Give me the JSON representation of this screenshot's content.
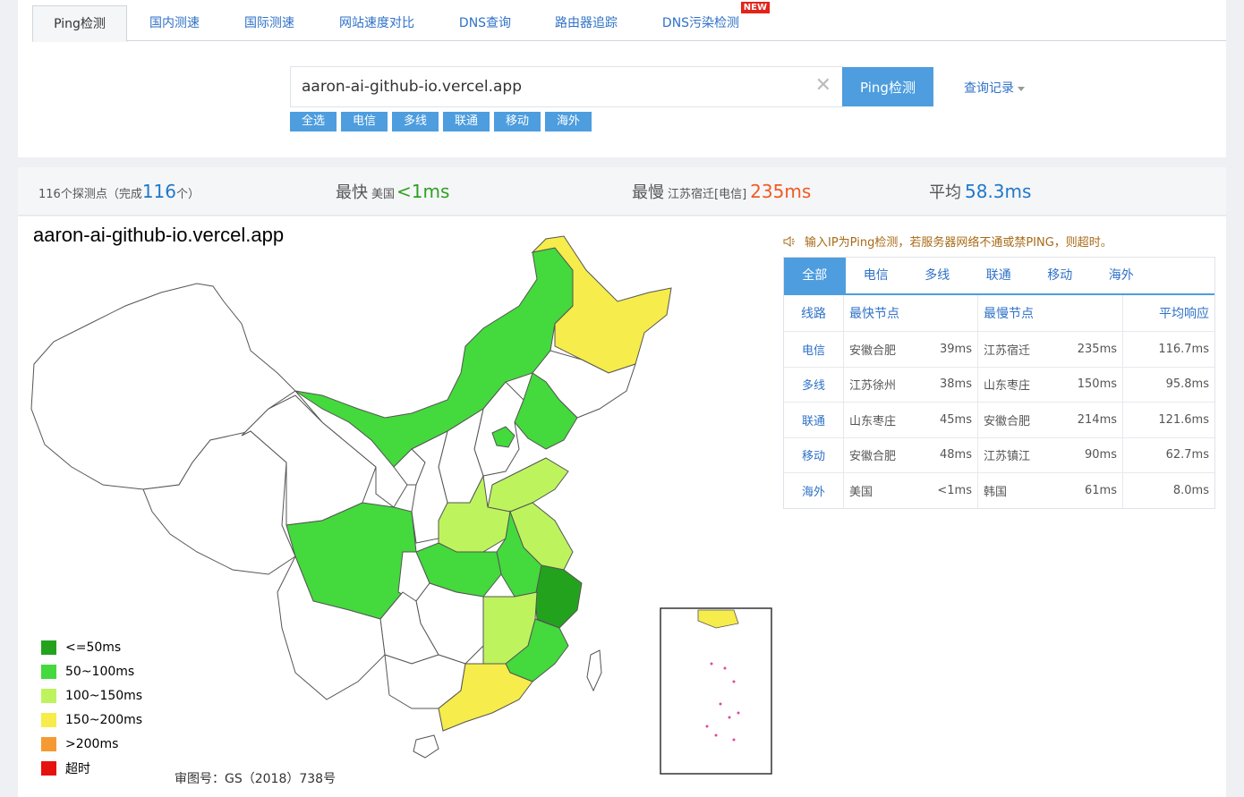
{
  "tabs": [
    {
      "label": "Ping检测",
      "active": true
    },
    {
      "label": "国内测速"
    },
    {
      "label": "国际测速"
    },
    {
      "label": "网站速度对比"
    },
    {
      "label": "DNS查询"
    },
    {
      "label": "路由器追踪"
    },
    {
      "label": "DNS污染检测",
      "badge": "NEW"
    }
  ],
  "search": {
    "value": "aaron-ai-github-io.vercel.app",
    "button_label": "Ping检测",
    "history_label": "查询记录"
  },
  "filters": [
    "全选",
    "电信",
    "多线",
    "联通",
    "移动",
    "海外"
  ],
  "stats": {
    "probe_count_label": "116个探测点（完成",
    "probe_done": "116",
    "probe_suffix": "个）",
    "fastest_label": "最快",
    "fastest_location": "美国",
    "fastest_value": "<1ms",
    "slowest_label": "最慢",
    "slowest_location": "江苏宿迁[电信]",
    "slowest_value": "235ms",
    "average_label": "平均",
    "average_value": "58.3ms"
  },
  "map": {
    "title": "aaron-ai-github-io.vercel.app",
    "approval": "审图号：GS（2018）738号",
    "legend": [
      {
        "label": "<=50ms",
        "color": "#23a21e"
      },
      {
        "label": "50~100ms",
        "color": "#44d93d"
      },
      {
        "label": "100~150ms",
        "color": "#bdf45e"
      },
      {
        "label": "150~200ms",
        "color": "#f6ec4b"
      },
      {
        "label": ">200ms",
        "color": "#f59a32"
      },
      {
        "label": "超时",
        "color": "#e6120f"
      }
    ],
    "region_colors": {
      "dark_green": "#23a21e",
      "green": "#44d93d",
      "light_green": "#bdf45e",
      "yellow": "#f6ec4b",
      "none": "#ffffff"
    }
  },
  "notice": "输入IP为Ping检测，若服务器网络不通或禁PING，则超时。",
  "result": {
    "tabs": [
      {
        "label": "全部",
        "active": true
      },
      {
        "label": "电信"
      },
      {
        "label": "多线"
      },
      {
        "label": "联通"
      },
      {
        "label": "移动"
      },
      {
        "label": "海外"
      }
    ],
    "headers": {
      "line": "线路",
      "fastest": "最快节点",
      "slowest": "最慢节点",
      "avg": "平均响应"
    },
    "rows": [
      {
        "line": "电信",
        "fast_node": "安徽合肥",
        "fast_ms": "39ms",
        "slow_node": "江苏宿迁",
        "slow_ms": "235ms",
        "avg": "116.7ms"
      },
      {
        "line": "多线",
        "fast_node": "江苏徐州",
        "fast_ms": "38ms",
        "slow_node": "山东枣庄",
        "slow_ms": "150ms",
        "avg": "95.8ms"
      },
      {
        "line": "联通",
        "fast_node": "山东枣庄",
        "fast_ms": "45ms",
        "slow_node": "安徽合肥",
        "slow_ms": "214ms",
        "avg": "121.6ms"
      },
      {
        "line": "移动",
        "fast_node": "安徽合肥",
        "fast_ms": "48ms",
        "slow_node": "江苏镇江",
        "slow_ms": "90ms",
        "avg": "62.7ms"
      },
      {
        "line": "海外",
        "fast_node": "美国",
        "fast_ms": "<1ms",
        "slow_node": "韩国",
        "slow_ms": "61ms",
        "avg": "8.0ms"
      }
    ]
  }
}
